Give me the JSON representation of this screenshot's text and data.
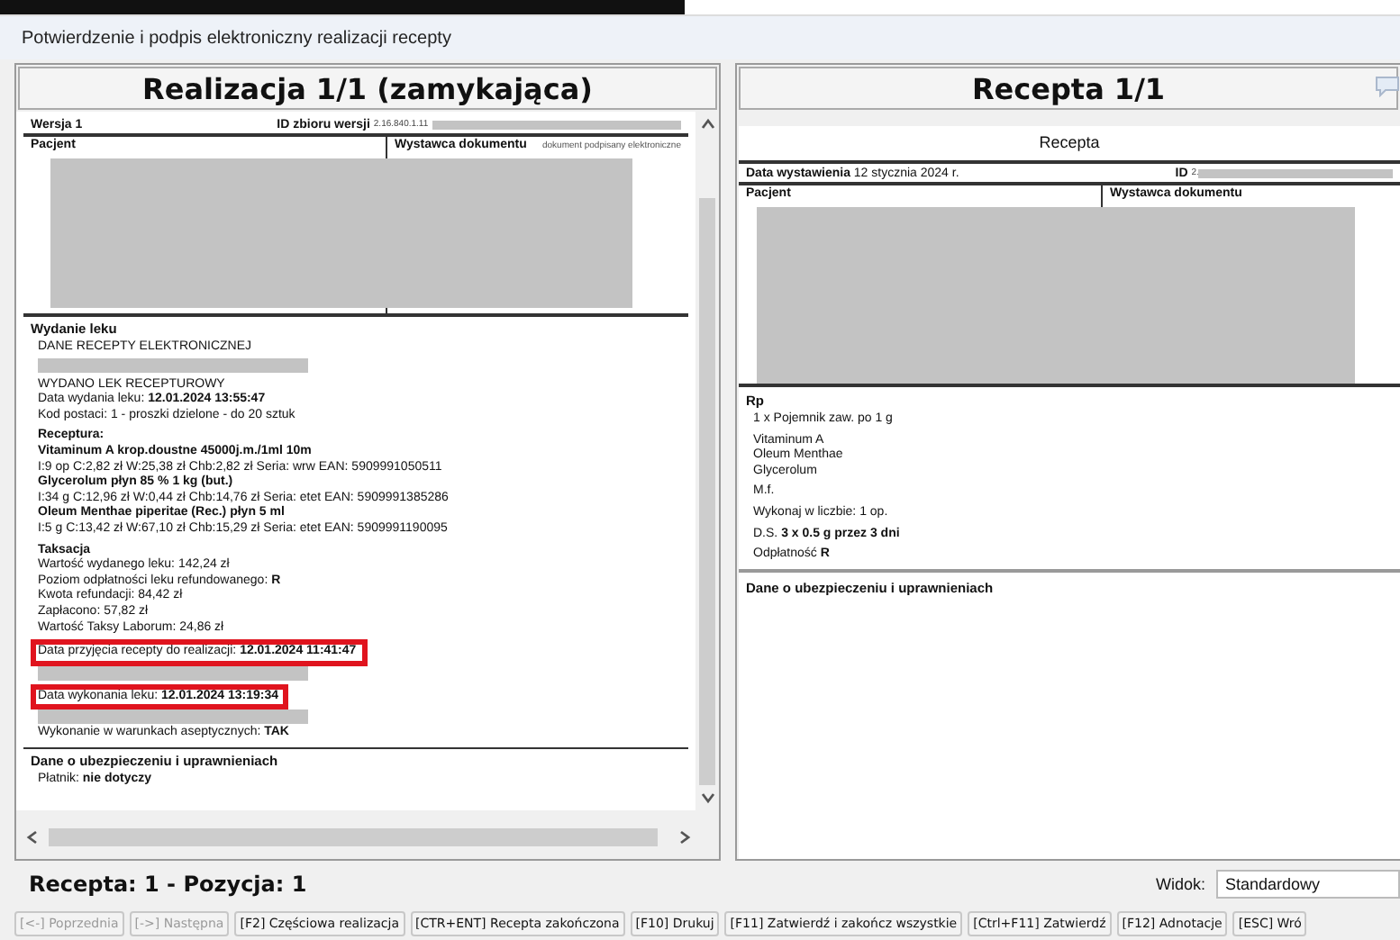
{
  "window": {
    "title": "Potwierdzenie i podpis elektroniczny realizacji recepty"
  },
  "left_panel": {
    "title": "Realizacja 1/1 (zamykająca)",
    "version": "Wersja 1",
    "version_id_label": "ID zbioru wersji",
    "version_id": "2.16.840.1.11",
    "patient_label": "Pacjent",
    "issuer_label": "Wystawca dokumentu",
    "issuer_note": "dokument podpisany elektroniczne",
    "dispense": {
      "heading": "Wydanie leku",
      "groups": [
        [
          {
            "kind": "text",
            "text": "DANE RECEPTY ELEKTRONICZNEJ",
            "highlighted": false
          },
          {
            "kind": "redacted",
            "highlighted": false
          }
        ],
        [
          {
            "kind": "text",
            "text": "WYDANO LEK RECEPTUROWY",
            "highlighted": false
          },
          {
            "kind": "text",
            "text": "Data wydania leku: **12.01.2024 13:55:47**",
            "highlighted": false
          },
          {
            "kind": "text",
            "text": "Kod postaci: 1 - proszki dzielone - do 20 sztuk",
            "highlighted": false
          }
        ],
        [
          {
            "kind": "heading",
            "text": "Receptura:",
            "highlighted": false
          },
          {
            "kind": "heading",
            "text": "Vitaminum A krop.doustne 45000j.m./1ml 10m",
            "highlighted": false
          },
          {
            "kind": "text",
            "text": "I:9 op C:2,82 zł W:25,38 zł Chb:2,82 zł Seria: wrw EAN: 5909991050511",
            "highlighted": false
          },
          {
            "kind": "heading",
            "text": "Glycerolum płyn 85 % 1 kg (but.)",
            "highlighted": false
          },
          {
            "kind": "text",
            "text": "I:34 g C:12,96 zł W:0,44 zł Chb:14,76 zł Seria: etet EAN: 5909991385286",
            "highlighted": false
          },
          {
            "kind": "heading",
            "text": "Oleum Menthae piperitae (Rec.) płyn 5 ml",
            "highlighted": false
          },
          {
            "kind": "text",
            "text": "I:5 g C:13,42 zł W:67,10 zł Chb:15,29 zł Seria: etet EAN: 5909991190095",
            "highlighted": false
          }
        ],
        [
          {
            "kind": "heading",
            "text": "Taksacja",
            "highlighted": false
          },
          {
            "kind": "text",
            "text": "Wartość wydanego leku: 142,24 zł",
            "highlighted": false
          },
          {
            "kind": "text",
            "text": "Poziom odpłatności leku refundowanego: **R**",
            "highlighted": false
          },
          {
            "kind": "text",
            "text": "Kwota refundacji: 84,42 zł",
            "highlighted": false
          },
          {
            "kind": "text",
            "text": "Zapłacono: 57,82 zł",
            "highlighted": false
          },
          {
            "kind": "text",
            "text": "Wartość Taksy Laborum: 24,86 zł",
            "highlighted": false
          }
        ],
        [
          {
            "kind": "text",
            "text": "Data przyjęcia recepty do realizacji: **12.01.2024 11:41:47**",
            "highlighted": true
          },
          {
            "kind": "redacted",
            "highlighted": false
          }
        ],
        [
          {
            "kind": "text",
            "text": "Data wykonania leku: **12.01.2024 13:19:34**",
            "highlighted": true
          },
          {
            "kind": "redacted",
            "highlighted": false
          },
          {
            "kind": "text",
            "text": "Wykonanie w warunkach aseptycznych: **TAK**",
            "highlighted": false
          }
        ]
      ]
    },
    "insurance": {
      "heading": "Dane o ubezpieczeniu i uprawnieniach",
      "payer": "Płatnik: **nie dotyczy**"
    }
  },
  "right_panel": {
    "title": "Recepta 1/1",
    "doc_title": "Recepta",
    "issue_date": "**Data wystawienia** 12 stycznia 2024 r.",
    "id_label": "ID",
    "id_value": "2.",
    "patient_label": "Pacjent",
    "issuer_label": "Wystawca dokumentu",
    "rp": {
      "heading": "Rp",
      "groups": [
        [
          "1 x Pojemnik zaw. po 1 g"
        ],
        [
          "Vitaminum A",
          "Oleum Menthae",
          "Glycerolum"
        ],
        [
          "M.f."
        ],
        [
          "Wykonaj w liczbie: 1 op."
        ],
        [
          "D.S. **3 x 0.5 g przez 3 dni**"
        ],
        [
          "Odpłatność **R**"
        ]
      ]
    },
    "insurance_heading": "Dane o ubezpieczeniu i uprawnieniach"
  },
  "status_bar": {
    "position": "Recepta: 1 - Pozycja: 1",
    "view_label": "Widok:",
    "view_value": "Standardowy"
  },
  "buttons": [
    {
      "label": "[<-] Poprzednia",
      "disabled": true
    },
    {
      "label": "[->] Następna",
      "disabled": true
    },
    {
      "label": "[F2] Częściowa realizacja",
      "disabled": false
    },
    {
      "label": "[CTR+ENT] Recepta zakończona",
      "disabled": false
    },
    {
      "label": "[F10] Drukuj",
      "disabled": false
    },
    {
      "label": "[F11] Zatwierdź i zakończ wszystkie",
      "disabled": false
    },
    {
      "label": "[Ctrl+F11] Zatwierdź",
      "disabled": false
    },
    {
      "label": "[F12] Adnotacje",
      "disabled": false
    },
    {
      "label": "[ESC] Wró",
      "disabled": false
    }
  ]
}
